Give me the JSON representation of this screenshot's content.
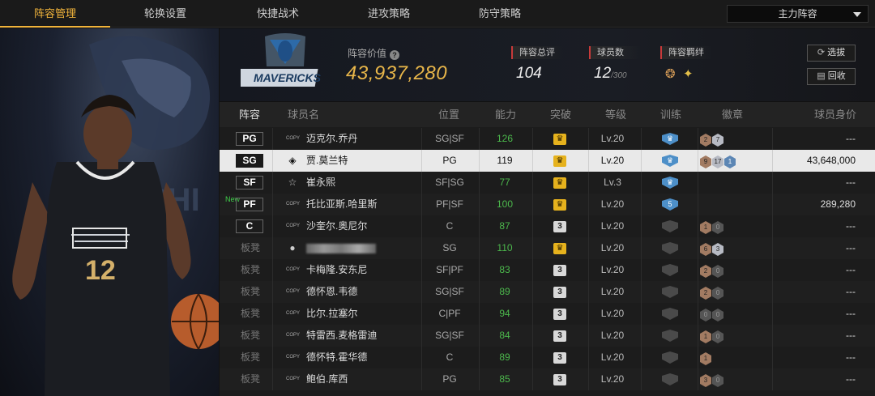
{
  "tabs": [
    "阵容管理",
    "轮换设置",
    "快捷战术",
    "进攻策略",
    "防守策略"
  ],
  "active_tab": "阵容管理",
  "lineup_select": "主力阵容",
  "header": {
    "team_logo_text": "MAVERICKS",
    "value_label": "阵容价值",
    "value": "43,937,280",
    "overall_label": "阵容总评",
    "overall_value": "104",
    "players_label": "球员数",
    "players_value": "12",
    "players_max": "/300",
    "synergy_label": "阵容羁绊",
    "select_button": "选拔",
    "recycle_button": "回收"
  },
  "columns": [
    "阵容",
    "球员名",
    "位置",
    "能力",
    "突破",
    "等级",
    "训练",
    "徽章",
    "球员身价"
  ],
  "card_label": "COPY",
  "rows": [
    {
      "slot": "PG",
      "bench": false,
      "isNew": false,
      "card": "copy",
      "name": "迈克尔.乔丹",
      "pos": "SG|SF",
      "ability": "126",
      "break": "crown",
      "level": "Lv.20",
      "train": "blue",
      "badges": [
        [
          "bronze",
          "2"
        ],
        [
          "silver",
          "7"
        ]
      ],
      "worth": "---"
    },
    {
      "slot": "SG",
      "bench": false,
      "isNew": false,
      "card": "diamond",
      "name": "贾.莫兰特",
      "pos": "PG",
      "ability": "119",
      "break": "crown",
      "level": "Lv.20",
      "train": "blue",
      "badges": [
        [
          "bronze",
          "9"
        ],
        [
          "silver",
          "17"
        ],
        [
          "gold",
          "1"
        ]
      ],
      "worth": "43,648,000",
      "selected": true
    },
    {
      "slot": "SF",
      "bench": false,
      "isNew": false,
      "card": "star",
      "name": "崔永熙",
      "pos": "SF|SG",
      "ability": "77",
      "break": "crown",
      "level": "Lv.3",
      "train": "blue",
      "badges": [],
      "worth": "---"
    },
    {
      "slot": "PF",
      "bench": false,
      "isNew": true,
      "card": "copy",
      "name": "托比亚斯.哈里斯",
      "pos": "PF|SF",
      "ability": "100",
      "break": "crown",
      "level": "Lv.20",
      "train": "blue5",
      "badges": [],
      "worth": "289,280"
    },
    {
      "slot": "C",
      "bench": false,
      "isNew": false,
      "card": "copy",
      "name": "沙奎尔.奥尼尔",
      "pos": "C",
      "ability": "87",
      "break": "3",
      "level": "Lv.20",
      "train": "gray",
      "badges": [
        [
          "bronze",
          "1"
        ],
        [
          "dark",
          "0"
        ]
      ],
      "worth": "---"
    },
    {
      "slot": "板凳",
      "bench": true,
      "isNew": false,
      "card": "user",
      "name": "",
      "pos": "SG",
      "ability": "110",
      "break": "crown",
      "level": "Lv.20",
      "train": "gray",
      "badges": [
        [
          "bronze",
          "6"
        ],
        [
          "silver",
          "3"
        ]
      ],
      "worth": "---",
      "blurred": true
    },
    {
      "slot": "板凳",
      "bench": true,
      "isNew": false,
      "card": "copy",
      "name": "卡梅隆.安东尼",
      "pos": "SF|PF",
      "ability": "83",
      "break": "3",
      "level": "Lv.20",
      "train": "gray",
      "badges": [
        [
          "bronze",
          "2"
        ],
        [
          "dark",
          "0"
        ]
      ],
      "worth": "---"
    },
    {
      "slot": "板凳",
      "bench": true,
      "isNew": false,
      "card": "copy",
      "name": "德怀恩.韦德",
      "pos": "SG|SF",
      "ability": "89",
      "break": "3",
      "level": "Lv.20",
      "train": "gray",
      "badges": [
        [
          "bronze",
          "2"
        ],
        [
          "dark",
          "0"
        ]
      ],
      "worth": "---"
    },
    {
      "slot": "板凳",
      "bench": true,
      "isNew": false,
      "card": "copy",
      "name": "比尔.拉塞尔",
      "pos": "C|PF",
      "ability": "94",
      "break": "3",
      "level": "Lv.20",
      "train": "gray",
      "badges": [
        [
          "dark",
          "0"
        ],
        [
          "dark",
          "0"
        ]
      ],
      "worth": "---"
    },
    {
      "slot": "板凳",
      "bench": true,
      "isNew": false,
      "card": "copy",
      "name": "特雷西.麦格雷迪",
      "pos": "SG|SF",
      "ability": "84",
      "break": "3",
      "level": "Lv.20",
      "train": "gray",
      "badges": [
        [
          "bronze",
          "1"
        ],
        [
          "dark",
          "0"
        ]
      ],
      "worth": "---"
    },
    {
      "slot": "板凳",
      "bench": true,
      "isNew": false,
      "card": "copy",
      "name": "德怀特.霍华德",
      "pos": "C",
      "ability": "89",
      "break": "3",
      "level": "Lv.20",
      "train": "gray",
      "badges": [
        [
          "bronze",
          "1"
        ]
      ],
      "worth": "---"
    },
    {
      "slot": "板凳",
      "bench": true,
      "isNew": false,
      "card": "copy",
      "name": "鲍伯.库西",
      "pos": "PG",
      "ability": "85",
      "break": "3",
      "level": "Lv.20",
      "train": "gray",
      "badges": [
        [
          "bronze",
          "3"
        ],
        [
          "dark",
          "0"
        ]
      ],
      "worth": "---"
    }
  ],
  "new_tag": "New",
  "jersey_number": "12"
}
